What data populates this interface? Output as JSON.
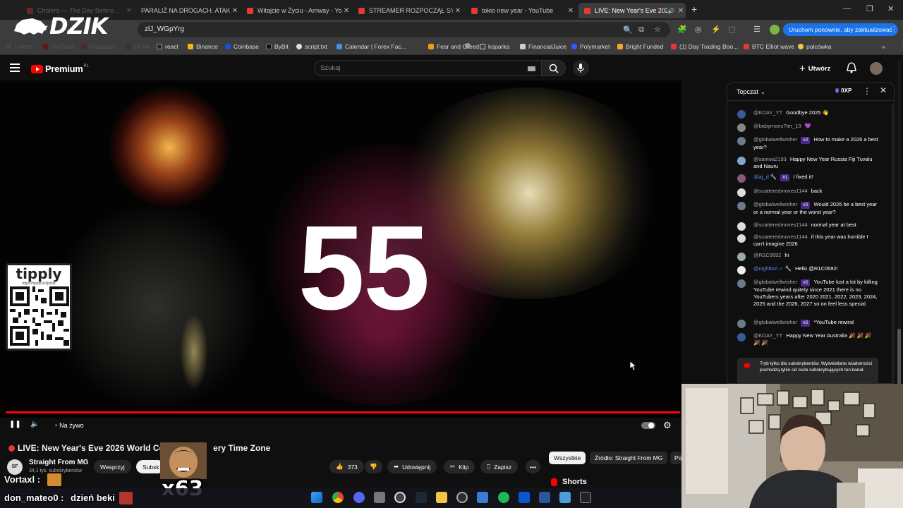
{
  "browser": {
    "tabs": [
      {
        "title": "Cholera — The Day Before...",
        "active": false
      },
      {
        "title": "PARALIŻ NA DROGACH. ATAK Z",
        "active": false
      },
      {
        "title": "Witajcie w Życiu - Amway - You",
        "active": false
      },
      {
        "title": "STREAMER ROZPOCZĄŁ SYLWE",
        "active": false
      },
      {
        "title": "tokio new year - YouTube",
        "active": false
      },
      {
        "title": "LIVE: New Year's Eve 202",
        "active": true
      }
    ],
    "url": "zlJ_WGpYrg",
    "update_button": "Uruchom ponownie, aby zaktualizować",
    "bookmarks": [
      "Twitter",
      "YouTube",
      "Instagram",
      "TikTok",
      "react",
      "Binance",
      "Coinbase",
      "ByBit",
      "script.txt",
      "Calendar | Forex Fac...",
      "Fear and Greed",
      "koparka",
      "FinancialJuice",
      "Polymarket",
      "Bright Funded",
      "(1) Day Trading Boo...",
      "BTC Elliot wave",
      "palcówka"
    ]
  },
  "overlay_logo": "DZIK",
  "youtube": {
    "logo_text": "Premium",
    "logo_region": "PL",
    "search_placeholder": "Szukaj",
    "create_label": "Utwórz"
  },
  "video": {
    "countdown": "55",
    "tipply_label": "tipply",
    "tipply_url": "https://tipply.pl/@dzik",
    "live_label": "Na żywo",
    "title_left": "LIVE: New Year's Eve 2026 World Cou",
    "title_right": "ery Time Zone",
    "channel_name": "Straight From MG",
    "channel_initials": "SF MG",
    "channel_subs": "34,1 tys. subskrybentów",
    "support_label": "Wesprzyj",
    "subscribe_label": "Subsk",
    "likes": "373",
    "share_label": "Udostępnij",
    "clip_label": "Klip",
    "save_label": "Zapisz"
  },
  "filters": [
    "Wszystkie",
    "Źródło: Straight From MG",
    "Po"
  ],
  "shorts_label": "Shorts",
  "chat": {
    "header": "Topczat",
    "xp": "0XP",
    "messages": [
      {
        "author": "@KDAY_YT",
        "badge": "",
        "text": "Goodbye 2025 👋",
        "mod": false
      },
      {
        "author": "@babymons7ter_13",
        "badge": "",
        "text": "💜",
        "mod": false
      },
      {
        "author": "@globalwellwisher",
        "badge": "#2",
        "text": "How to make a 2026 a best year?",
        "mod": false
      },
      {
        "author": "@samoa2193",
        "badge": "",
        "text": "Happy New Year Russia Fiji Tuvalu and Nauru",
        "mod": false
      },
      {
        "author": "@aj_d 🔧",
        "badge": "#1",
        "text": "I fixed it!",
        "mod": true
      },
      {
        "author": "@scatteredmoves1144",
        "badge": "",
        "text": "back",
        "mod": false
      },
      {
        "author": "@globalwellwisher",
        "badge": "#2",
        "text": "Would 2026 be a best year or a normal year or the worst year?",
        "mod": false
      },
      {
        "author": "@scatteredmoves1144",
        "badge": "",
        "text": "normal year at best",
        "mod": false
      },
      {
        "author": "@scatteredmoves1144",
        "badge": "",
        "text": "if this year was horrible I can't imagine 2026",
        "mod": false
      },
      {
        "author": "@R1C0692",
        "badge": "",
        "text": "hi",
        "mod": false
      },
      {
        "author": "@nightbot ✓ 🔧",
        "badge": "",
        "text": "Hello @R1C0692!",
        "mod": true
      },
      {
        "author": "@globalwellwisher",
        "badge": "#2",
        "text": "YouTube lost a lot by killing YouTube rewind quitely since 2021 there is no YouTubers years after 2020 2021, 2022, 2023, 2024, 2025 and the 2026, 2027 so on feel less special.",
        "mod": false
      },
      {
        "author": "@globalwellwisher",
        "badge": "#2",
        "text": "*YouTube rewind",
        "mod": false
      },
      {
        "author": "@KDAY_YT",
        "badge": "",
        "text": "Happy New Year Australia 🎉 🎉 🎉 🎉 🎉",
        "mod": false
      }
    ],
    "subscriber_notice": "Tryb tylko dla subskrybentów. Wyświetlane wiadomości pochodzą tylko od osób subskrybujących ten kanał."
  },
  "stream_overlay": {
    "alert1_user": "Vortaxl :",
    "alert2_user": "don_mateo0 :",
    "alert2_text": "dzień beki",
    "multiplier": "x63"
  }
}
